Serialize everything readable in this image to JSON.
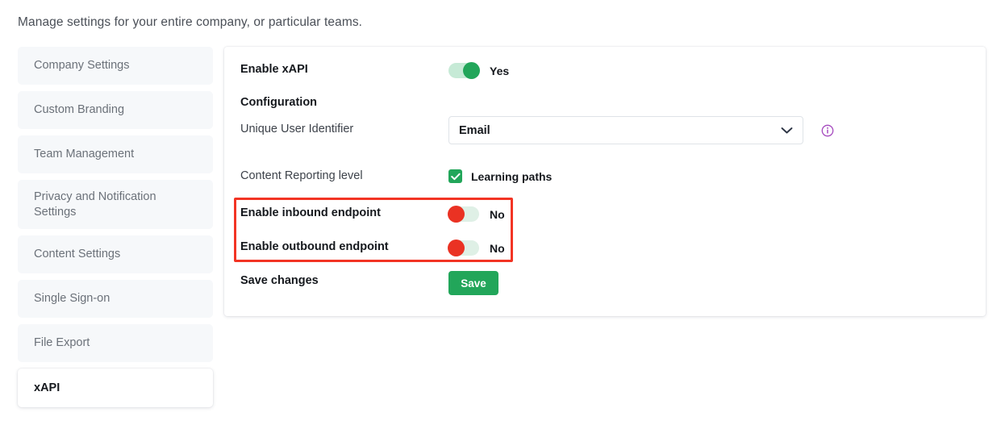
{
  "header": {
    "subtitle": "Manage settings for your entire company, or particular teams."
  },
  "sidebar": {
    "items": [
      {
        "label": "Company Settings",
        "active": false
      },
      {
        "label": "Custom Branding",
        "active": false
      },
      {
        "label": "Team Management",
        "active": false
      },
      {
        "label": "Privacy and Notification Settings",
        "active": false
      },
      {
        "label": "Content Settings",
        "active": false
      },
      {
        "label": "Single Sign-on",
        "active": false
      },
      {
        "label": "File Export",
        "active": false
      },
      {
        "label": "xAPI",
        "active": true
      }
    ]
  },
  "panel": {
    "enable_xapi": {
      "label": "Enable xAPI",
      "toggle_state": "Yes",
      "toggle_on": true
    },
    "configuration_heading": "Configuration",
    "unique_user_identifier": {
      "label": "Unique User Identifier",
      "selected": "Email",
      "options": [
        "Email"
      ],
      "info_icon": "info-circle-icon",
      "chevron_icon": "chevron-down-icon"
    },
    "content_reporting": {
      "label": "Content Reporting level",
      "checkbox_label": "Learning paths",
      "checked": true
    },
    "inbound_endpoint": {
      "label": "Enable inbound endpoint",
      "toggle_state": "No",
      "toggle_on": false
    },
    "outbound_endpoint": {
      "label": "Enable outbound endpoint",
      "toggle_state": "No",
      "toggle_on": false
    },
    "save": {
      "label": "Save changes",
      "button_label": "Save"
    }
  },
  "colors": {
    "accent_green": "#22a65a",
    "toggle_off_red": "#ea3223",
    "highlight_red": "#f23424",
    "info_purple": "#a64bbf",
    "sidebar_bg": "#f6f8fa"
  }
}
